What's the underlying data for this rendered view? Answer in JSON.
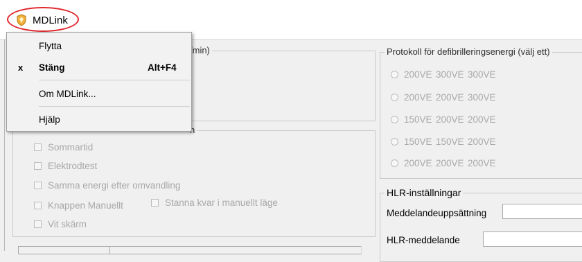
{
  "title_bar": {
    "title": "MDLink",
    "icon": "app-shield-icon"
  },
  "annotation": {
    "color": "#e0262b"
  },
  "system_menu": {
    "items": [
      {
        "label": "Flytta",
        "mark": "",
        "accelerator": "",
        "bold": false
      },
      {
        "label": "Stäng",
        "mark": "x",
        "accelerator": "Alt+F4",
        "bold": true
      },
      {
        "label": "Om MDLink...",
        "mark": "",
        "accelerator": "",
        "bold": false
      },
      {
        "label": "Hjälp",
        "mark": "",
        "accelerator": "",
        "bold": false
      }
    ]
  },
  "left_top_group": {
    "legend_partial": "/min)"
  },
  "left_bottom_group": {
    "legend_partial": "n",
    "checkboxes": [
      {
        "label": "Sommartid",
        "checked": false,
        "enabled": false
      },
      {
        "label": "Elektrodtest",
        "checked": false,
        "enabled": false
      },
      {
        "label": "Samma energi efter omvandling",
        "checked": false,
        "enabled": false
      },
      {
        "label": "Knappen Manuellt",
        "checked": false,
        "enabled": false
      },
      {
        "label": "Stanna kvar i manuellt läge",
        "checked": false,
        "enabled": false
      },
      {
        "label": "Vit skärm",
        "checked": false,
        "enabled": false
      }
    ]
  },
  "protocol_group": {
    "legend": "Protokoll för defibrilleringsenergi (välj ett)",
    "options": [
      [
        "200VE",
        "300VE",
        "300VE"
      ],
      [
        "200VE",
        "200VE",
        "300VE"
      ],
      [
        "150VE",
        "200VE",
        "200VE"
      ],
      [
        "150VE",
        "150VE",
        "200VE"
      ],
      [
        "200VE",
        "200VE",
        "200VE"
      ]
    ]
  },
  "hlr_group": {
    "legend": "HLR-inställningar",
    "fields": [
      {
        "label": "Meddelandeuppsättning",
        "value": ""
      },
      {
        "label": "HLR-meddelande",
        "value": ""
      }
    ]
  }
}
